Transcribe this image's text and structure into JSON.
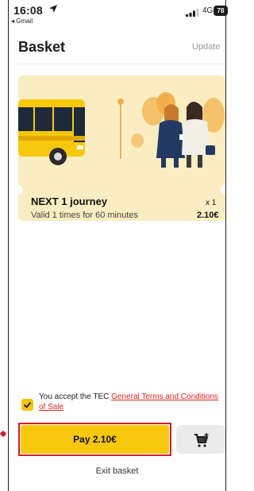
{
  "status_bar": {
    "time": "16:08",
    "back_app": "◂ Gmail",
    "network": "4G",
    "battery": "78"
  },
  "header": {
    "title": "Basket",
    "update_label": "Update"
  },
  "ticket": {
    "name": "NEXT 1 journey",
    "validity": "Valid 1 times for 60 minutes",
    "quantity": "x 1",
    "price": "2.10€"
  },
  "terms": {
    "prefix": "You accept the TEC ",
    "link": "General Terms and Conditions of Sale",
    "checked": true
  },
  "actions": {
    "pay_label": "Pay 2.10€",
    "exit_label": "Exit basket"
  },
  "colors": {
    "accent_yellow": "#f8c80c",
    "ticket_bg": "#faedc1",
    "link_red": "#e2231a",
    "highlight_red": "#d6192f"
  },
  "icons": {
    "location": "location-arrow-icon",
    "signal": "cellular-signal-icon",
    "checkbox": "check-icon",
    "cart": "add-to-cart-icon"
  }
}
